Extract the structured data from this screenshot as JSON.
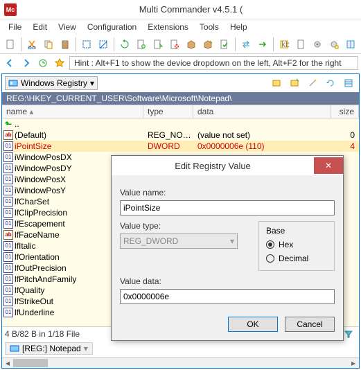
{
  "app": {
    "title": "Multi Commander v4.5.1 ("
  },
  "menu": [
    "File",
    "Edit",
    "View",
    "Configuration",
    "Extensions",
    "Tools",
    "Help"
  ],
  "hint": "Hint : Alt+F1 to show the device dropdown on the left, Alt+F2 for the right",
  "panel": {
    "dropdown_label": "Windows Registry",
    "path": "REG:\\HKEY_CURRENT_USER\\Software\\Microsoft\\Notepad\\",
    "columns": {
      "name": "name",
      "type": "type",
      "data": "data",
      "size": "size"
    }
  },
  "rows": [
    {
      "name": "..",
      "kind": "up"
    },
    {
      "name": "(Default)",
      "kind": "ab",
      "type": "REG_NO…",
      "data": "(value not set)",
      "size": "0"
    },
    {
      "name": "iPointSize",
      "kind": "bin",
      "type": "DWORD",
      "data": "0x0000006e (110)",
      "size": "4",
      "red": true
    },
    {
      "name": "iWindowPosDX",
      "kind": "bin"
    },
    {
      "name": "iWindowPosDY",
      "kind": "bin"
    },
    {
      "name": "iWindowPosX",
      "kind": "bin"
    },
    {
      "name": "iWindowPosY",
      "kind": "bin"
    },
    {
      "name": "lfCharSet",
      "kind": "bin"
    },
    {
      "name": "lfClipPrecision",
      "kind": "bin"
    },
    {
      "name": "lfEscapement",
      "kind": "bin"
    },
    {
      "name": "lfFaceName",
      "kind": "ab"
    },
    {
      "name": "lfItalic",
      "kind": "bin"
    },
    {
      "name": "lfOrientation",
      "kind": "bin"
    },
    {
      "name": "lfOutPrecision",
      "kind": "bin"
    },
    {
      "name": "lfPitchAndFamily",
      "kind": "bin"
    },
    {
      "name": "lfQuality",
      "kind": "bin"
    },
    {
      "name": "lfStrikeOut",
      "kind": "bin"
    },
    {
      "name": "lfUnderline",
      "kind": "bin"
    }
  ],
  "status": "4 B/82 B in 1/18 File",
  "tab": "[REG:] Notepad",
  "dialog": {
    "title": "Edit Registry Value",
    "valuename_label": "Value name:",
    "valuename": "iPointSize",
    "valuetype_label": "Value type:",
    "valuetype": "REG_DWORD",
    "base_label": "Base",
    "hex_label": "Hex",
    "dec_label": "Decimal",
    "valuedata_label": "Value data:",
    "valuedata": "0x0000006e",
    "ok": "OK",
    "cancel": "Cancel"
  }
}
